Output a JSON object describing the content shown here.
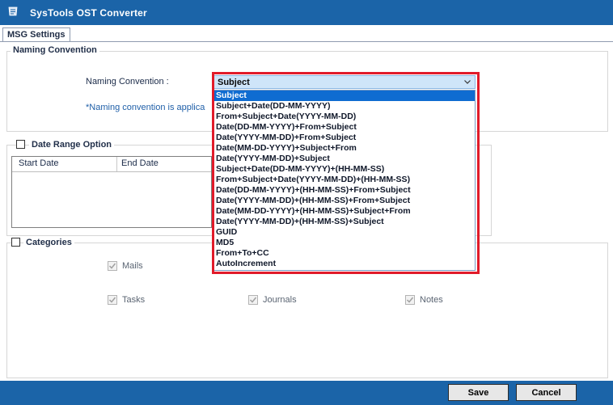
{
  "window": {
    "title": "SysTools OST Converter"
  },
  "tabs": [
    {
      "label": "MSG Settings"
    }
  ],
  "naming": {
    "group_title": "Naming Convention",
    "field_label": "Naming Convention :",
    "note": "*Naming convention is applica",
    "selected_value": "Subject",
    "options": [
      "Subject",
      "Subject+Date(DD-MM-YYYY)",
      "From+Subject+Date(YYYY-MM-DD)",
      "Date(DD-MM-YYYY)+From+Subject",
      "Date(YYYY-MM-DD)+From+Subject",
      "Date(MM-DD-YYYY)+Subject+From",
      "Date(YYYY-MM-DD)+Subject",
      "Subject+Date(DD-MM-YYYY)+(HH-MM-SS)",
      "From+Subject+Date(YYYY-MM-DD)+(HH-MM-SS)",
      "Date(DD-MM-YYYY)+(HH-MM-SS)+From+Subject",
      "Date(YYYY-MM-DD)+(HH-MM-SS)+From+Subject",
      "Date(MM-DD-YYYY)+(HH-MM-SS)+Subject+From",
      "Date(YYYY-MM-DD)+(HH-MM-SS)+Subject",
      "GUID",
      "MD5",
      "From+To+CC",
      "AutoIncrement"
    ]
  },
  "date_range": {
    "label": "Date Range Option",
    "columns": [
      "Start Date",
      "End Date"
    ]
  },
  "categories": {
    "label": "Categories",
    "items": [
      {
        "label": "Mails"
      },
      {
        "label": "Tasks"
      },
      {
        "label": "Journals"
      },
      {
        "label": "Notes"
      }
    ]
  },
  "buttons": {
    "save": "Save",
    "cancel": "Cancel"
  },
  "colors": {
    "titlebar": "#1b64a8",
    "highlight_border": "#e11b2a",
    "selected_option": "#0f6cd1"
  }
}
